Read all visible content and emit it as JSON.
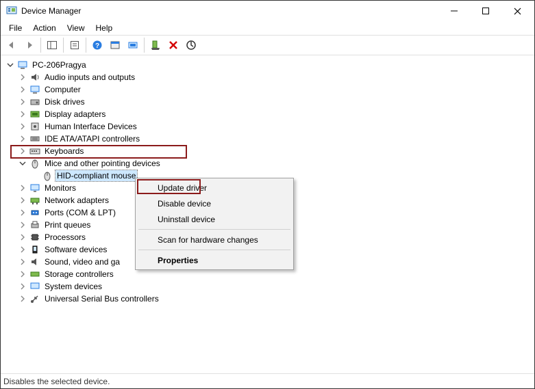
{
  "window": {
    "title": "Device Manager"
  },
  "menu": {
    "file": "File",
    "action": "Action",
    "view": "View",
    "help": "Help"
  },
  "tree": {
    "root": "PC-206Pragya",
    "categories": [
      "Audio inputs and outputs",
      "Computer",
      "Disk drives",
      "Display adapters",
      "Human Interface Devices",
      "IDE ATA/ATAPI controllers",
      "Keyboards",
      "Mice and other pointing devices",
      "Monitors",
      "Network adapters",
      "Ports (COM & LPT)",
      "Print queues",
      "Processors",
      "Software devices",
      "Sound, video and ga",
      "Storage controllers",
      "System devices",
      "Universal Serial Bus controllers"
    ],
    "mouse_child": "HID-compliant mouse"
  },
  "context": {
    "update": "Update driver",
    "disable": "Disable device",
    "uninstall": "Uninstall device",
    "scan": "Scan for hardware changes",
    "properties": "Properties"
  },
  "status": "Disables the selected device."
}
